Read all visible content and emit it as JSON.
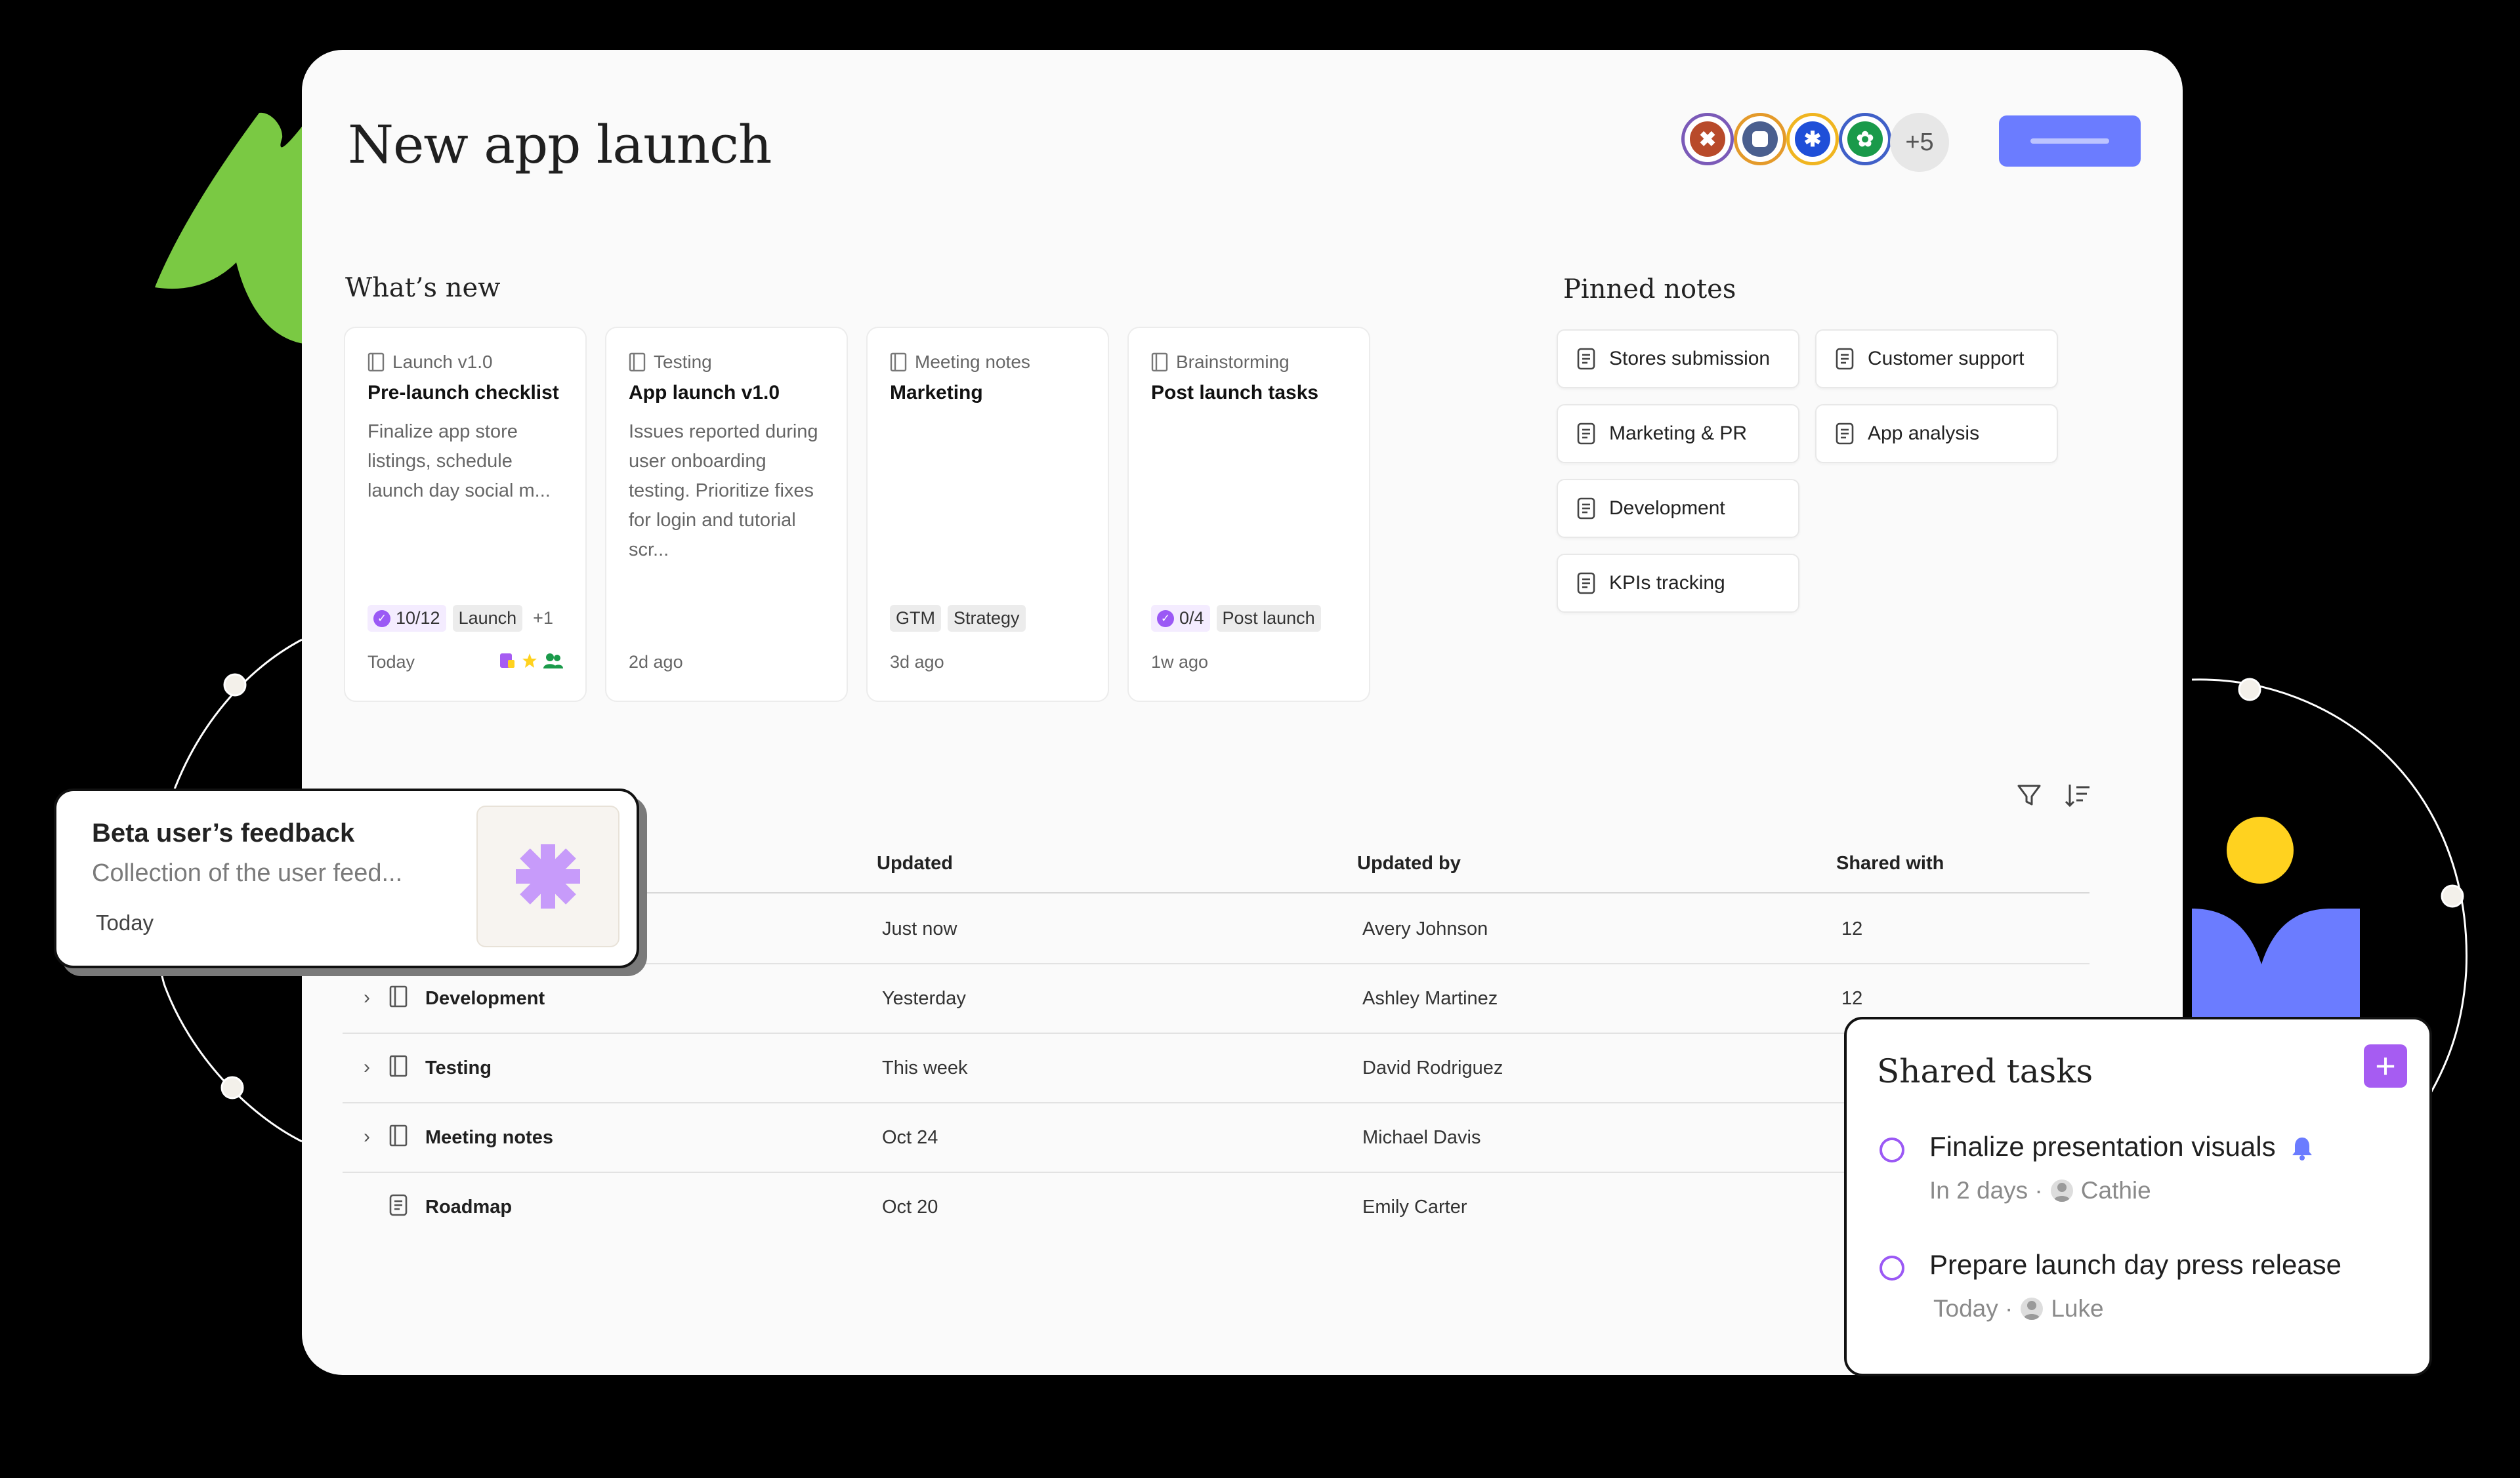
{
  "header": {
    "title": "New app launch",
    "avatars_more": "+5"
  },
  "avatars": [
    {
      "icon": "avatar-flower-orange-icon",
      "color": "#b84a2a",
      "ring": "#7b5ab8"
    },
    {
      "icon": "avatar-square-blue-icon",
      "color": "#4a5f8f",
      "ring": "#e49a2a"
    },
    {
      "icon": "avatar-asterisk-blue-icon",
      "color": "#1f4fd8",
      "ring": "#f0b520"
    },
    {
      "icon": "avatar-clover-green-icon",
      "color": "#1a9a4a",
      "ring": "#4060c8"
    }
  ],
  "whats_new": {
    "title": "What’s new",
    "cards": [
      {
        "category": "Launch v1.0",
        "title": "Pre-launch checklist",
        "description": "Finalize app store listings, schedule launch day social m...",
        "progress": "10/12",
        "tags": [
          "Launch"
        ],
        "more": "+1",
        "time": "Today"
      },
      {
        "category": "Testing",
        "title": "App launch v1.0",
        "description": "Issues reported during user onboarding testing. Prioritize fixes for login and tutorial scr...",
        "progress": "",
        "tags": [],
        "more": "",
        "time": "2d ago"
      },
      {
        "category": "Meeting notes",
        "title": "Marketing",
        "description": "",
        "progress": "",
        "tags": [
          "GTM",
          "Strategy"
        ],
        "more": "",
        "time": "3d ago"
      },
      {
        "category": "Brainstorming",
        "title": "Post launch tasks",
        "description": "",
        "progress": "0/4",
        "tags": [
          "Post launch"
        ],
        "more": "",
        "time": "1w ago"
      }
    ]
  },
  "pinned": {
    "title": "Pinned notes",
    "items": [
      "Stores submission",
      "Customer support",
      "Marketing & PR",
      "App analysis",
      "Development",
      "KPIs tracking"
    ]
  },
  "table": {
    "headers": [
      "Updated",
      "Updated by",
      "Shared with"
    ],
    "rows": [
      {
        "name": "",
        "updated": "Just now",
        "updated_by": "Avery Johnson",
        "shared": "12"
      },
      {
        "name": "Development",
        "updated": "Yesterday",
        "updated_by": "Ashley Martinez",
        "shared": "12"
      },
      {
        "name": "Testing",
        "updated": "This week",
        "updated_by": "David Rodriguez",
        "shared": ""
      },
      {
        "name": "Meeting notes",
        "updated": "Oct 24",
        "updated_by": "Michael Davis",
        "shared": ""
      },
      {
        "name": "Roadmap",
        "updated": "Oct 20",
        "updated_by": "Emily Carter",
        "shared": ""
      }
    ]
  },
  "feedback": {
    "title": "Beta user’s feedback",
    "description": "Collection of the user feed...",
    "time": "Today"
  },
  "shared_tasks": {
    "title": "Shared tasks",
    "add_label": "+",
    "tasks": [
      {
        "text": "Finalize presentation visuals",
        "due": "In 2 days ·",
        "assignee": "Cathie"
      },
      {
        "text": "Prepare launch day press release",
        "due": "Today ·",
        "assignee": "Luke"
      }
    ]
  },
  "colors": {
    "accent": "#6b7cff",
    "purple": "#a65cf2",
    "green": "#7ac943",
    "yellow": "#ffd21f"
  }
}
